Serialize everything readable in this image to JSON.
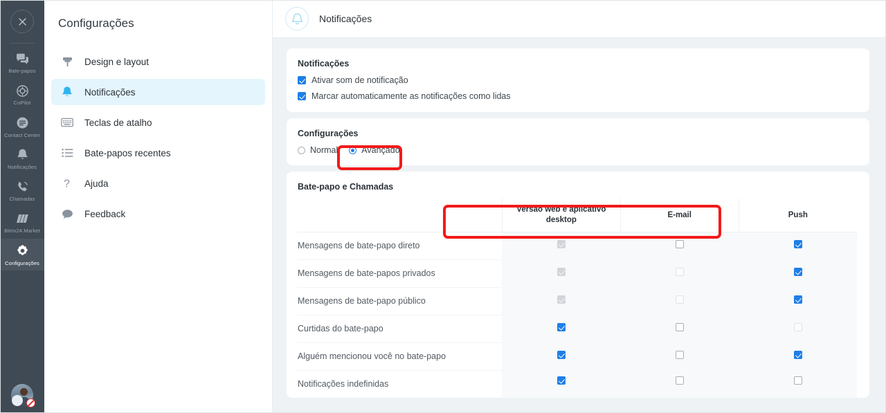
{
  "rail": {
    "close_label": "×",
    "items": [
      {
        "label": "Bate-papos",
        "icon": "chats-icon",
        "active": false
      },
      {
        "label": "CoPilot",
        "icon": "copilot-icon",
        "active": false
      },
      {
        "label": "Contact Center",
        "icon": "contact-center-icon",
        "active": false
      },
      {
        "label": "Notificações",
        "icon": "bell-icon",
        "active": false
      },
      {
        "label": "Chamadas",
        "icon": "phone-icon",
        "active": false
      },
      {
        "label": "Bitrix24.Market",
        "icon": "market-icon",
        "active": false
      },
      {
        "label": "Configurações",
        "icon": "gear-icon",
        "active": true
      }
    ],
    "avatar_name": "user-avatar",
    "avatar_status": "do-not-disturb"
  },
  "nav": {
    "title": "Configurações",
    "items": [
      {
        "label": "Design e layout",
        "icon": "paint-roller-icon",
        "active": false
      },
      {
        "label": "Notificações",
        "icon": "bell-icon",
        "active": true
      },
      {
        "label": "Teclas de atalho",
        "icon": "keyboard-icon",
        "active": false
      },
      {
        "label": "Bate-papos recentes",
        "icon": "list-icon",
        "active": false
      },
      {
        "label": "Ajuda",
        "icon": "question-icon",
        "active": false
      },
      {
        "label": "Feedback",
        "icon": "speech-bubble-icon",
        "active": false
      }
    ]
  },
  "header": {
    "title": "Notificações",
    "icon": "bell-icon"
  },
  "notifications_card": {
    "heading": "Notificações",
    "options": [
      {
        "label": "Ativar som de notificação",
        "state": "on"
      },
      {
        "label": "Marcar automaticamente as notificações como lidas",
        "state": "on"
      }
    ]
  },
  "settings_card": {
    "heading": "Configurações",
    "options": [
      {
        "label": "Normal",
        "selected": false
      },
      {
        "label": "Avançado",
        "selected": true
      }
    ]
  },
  "matrix_card": {
    "heading": "Bate-papo e Chamadas",
    "columns": [
      "Versão web e aplicativo desktop",
      "E-mail",
      "Push"
    ],
    "rows": [
      {
        "label": "Mensagens de bate-papo direto",
        "states": [
          "on-dis",
          "off",
          "on"
        ]
      },
      {
        "label": "Mensagens de bate-papos privados",
        "states": [
          "on-dis",
          "off-dis",
          "on"
        ]
      },
      {
        "label": "Mensagens de bate-papo público",
        "states": [
          "on-dis",
          "off-dis",
          "on"
        ]
      },
      {
        "label": "Curtidas do bate-papo",
        "states": [
          "on",
          "off",
          "off-dis"
        ]
      },
      {
        "label": "Alguém mencionou você no bate-papo",
        "states": [
          "on",
          "off",
          "on"
        ]
      },
      {
        "label": "Notificações indefinidas",
        "states": [
          "on",
          "off",
          "off"
        ]
      }
    ]
  },
  "annotations": [
    {
      "name": "highlight-advanced-radio",
      "color": "#f21a1a"
    },
    {
      "name": "highlight-channel-columns",
      "color": "#f21a1a"
    }
  ],
  "colors": {
    "accent": "#2fb5ef",
    "checkbox_on": "#1f7fe8",
    "rail_bg": "#404a54",
    "page_bg": "#eef2f4",
    "annotation": "#f21a1a"
  }
}
